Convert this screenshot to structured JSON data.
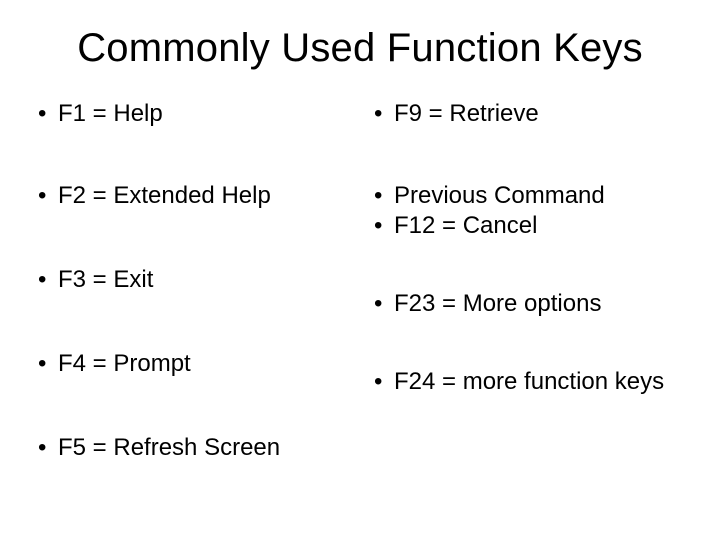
{
  "title": "Commonly Used Function Keys",
  "left": [
    "F1 = Help",
    "F2 = Extended Help",
    "F3 = Exit",
    "F4 = Prompt",
    "F5 = Refresh Screen"
  ],
  "right": [
    "F9 = Retrieve",
    "Previous Command",
    "F12 = Cancel",
    "F23 = More options",
    "F24 = more function keys"
  ]
}
